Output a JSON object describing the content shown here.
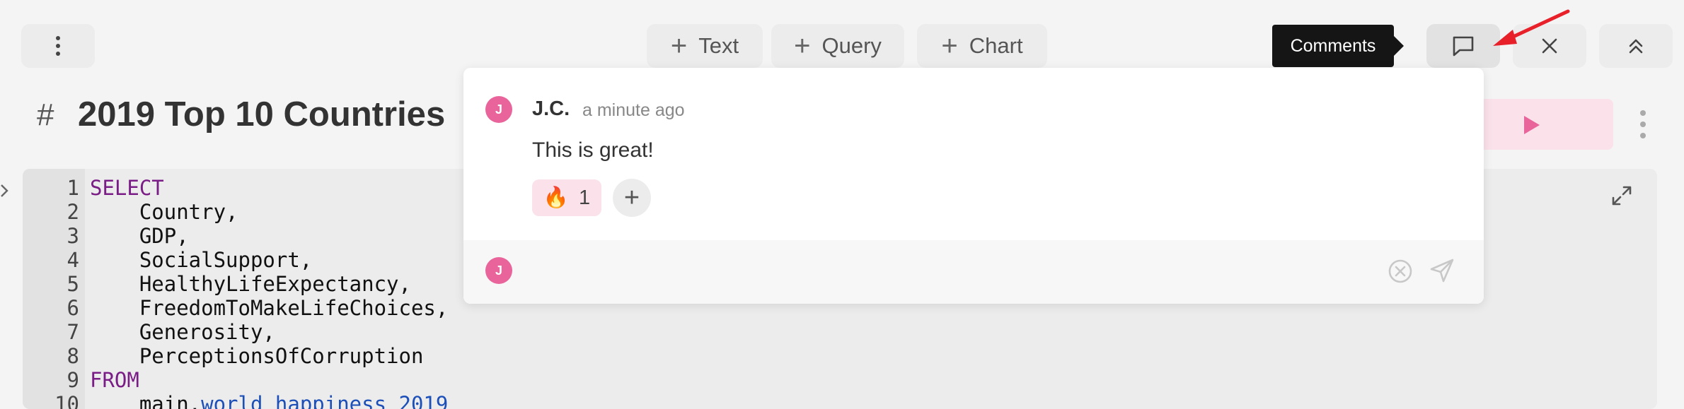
{
  "toolbar": {
    "add_text_label": "Text",
    "add_query_label": "Query",
    "add_chart_label": "Chart"
  },
  "tooltip": {
    "comments": "Comments"
  },
  "block": {
    "title_prefix": "#",
    "title": "2019 Top 10 Countries"
  },
  "editor": {
    "lines": [
      {
        "num": "1",
        "text": "SELECT"
      },
      {
        "num": "2",
        "text": "    Country,"
      },
      {
        "num": "3",
        "text": "    GDP,"
      },
      {
        "num": "4",
        "text": "    SocialSupport,"
      },
      {
        "num": "5",
        "text": "    HealthyLifeExpectancy,"
      },
      {
        "num": "6",
        "text": "    FreedomToMakeLifeChoices,"
      },
      {
        "num": "7",
        "text": "    Generosity,"
      },
      {
        "num": "8",
        "text": "    PerceptionsOfCorruption"
      },
      {
        "num": "9",
        "text": "FROM"
      },
      {
        "num": "10",
        "prefix": "    main.",
        "table": "world_happiness_2019"
      }
    ]
  },
  "comments": {
    "items": [
      {
        "avatar_initial": "J",
        "author": "J.C.",
        "time": "a minute ago",
        "body": "This is great!",
        "reaction": {
          "emoji": "🔥",
          "count": "1"
        }
      }
    ],
    "reply": {
      "avatar_initial": "J",
      "placeholder": ""
    }
  },
  "colors": {
    "accent": "#e8649a",
    "accent_light": "#fbe1e9",
    "keyword": "#7a1d86",
    "table": "#1c4fb8",
    "annotation_arrow": "#e8202a"
  },
  "icons": {
    "menu": "vertical-dots-icon",
    "comments": "chat-bubble-icon",
    "close": "close-icon",
    "collapse": "double-chevron-up-icon",
    "run": "play-icon",
    "expand": "expand-icon",
    "cancel": "circle-x-icon",
    "send": "send-icon"
  }
}
